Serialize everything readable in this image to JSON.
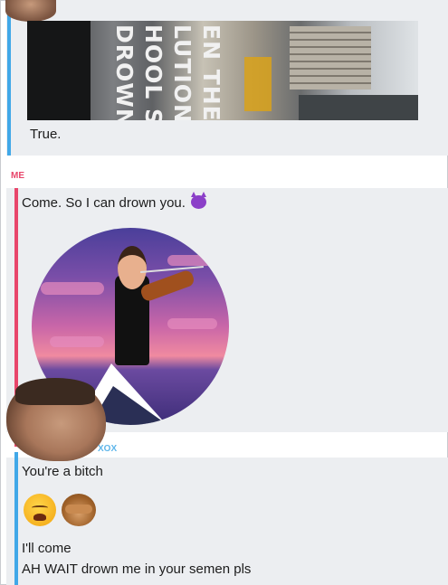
{
  "friend_message": {
    "video_overlay_text": [
      "EN THE",
      "LUTION",
      "HOOL SH",
      "DROWN"
    ],
    "caption": "True."
  },
  "me_section": {
    "label": "ME",
    "message": "Come. So I can drown you.",
    "emoji_icon": "smiling-devil-icon"
  },
  "friend_section": {
    "label_partial": "XOX",
    "messages": [
      "You're a bitch",
      "I'll come",
      "AH WAIT drown me in your semen pls"
    ],
    "emojis": [
      "weary-face-emoji",
      "see-no-evil-monkey-emoji"
    ]
  },
  "colors": {
    "friend_accent": "#41a8e8",
    "me_accent": "#e8466b",
    "bubble_bg": "#eceef1"
  }
}
